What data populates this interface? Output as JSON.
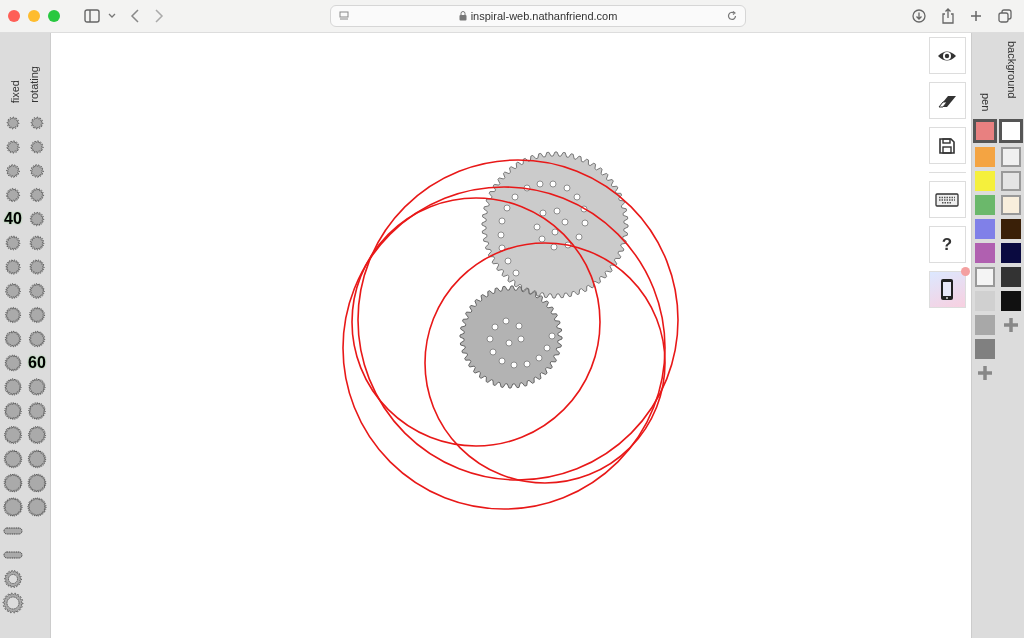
{
  "browser": {
    "url": "inspiral-web.nathanfriend.com"
  },
  "gear_picker": {
    "fixed_label": "fixed",
    "rotating_label": "rotating",
    "fixed": [
      {
        "kind": "gear",
        "selected": false
      },
      {
        "kind": "gear",
        "selected": false
      },
      {
        "kind": "gear",
        "selected": false
      },
      {
        "kind": "gear",
        "selected": false
      },
      {
        "kind": "gear",
        "selected": true,
        "label": "40"
      },
      {
        "kind": "gear",
        "selected": false
      },
      {
        "kind": "gear",
        "selected": false
      },
      {
        "kind": "gear",
        "selected": false
      },
      {
        "kind": "gear",
        "selected": false
      },
      {
        "kind": "gear",
        "selected": false
      },
      {
        "kind": "gear",
        "selected": false
      },
      {
        "kind": "gear",
        "selected": false
      },
      {
        "kind": "gear",
        "selected": false
      },
      {
        "kind": "gear",
        "selected": false
      },
      {
        "kind": "gear",
        "selected": false
      },
      {
        "kind": "gear",
        "selected": false
      },
      {
        "kind": "gear",
        "selected": false
      },
      {
        "kind": "rail",
        "selected": false
      },
      {
        "kind": "rail",
        "selected": false
      },
      {
        "kind": "ring",
        "selected": false
      },
      {
        "kind": "ring",
        "selected": false
      }
    ],
    "rotating": [
      {
        "kind": "gear",
        "selected": false
      },
      {
        "kind": "gear",
        "selected": false
      },
      {
        "kind": "gear",
        "selected": false
      },
      {
        "kind": "gear",
        "selected": false
      },
      {
        "kind": "gear",
        "selected": false
      },
      {
        "kind": "gear",
        "selected": false
      },
      {
        "kind": "gear",
        "selected": false
      },
      {
        "kind": "gear",
        "selected": false
      },
      {
        "kind": "gear",
        "selected": false
      },
      {
        "kind": "gear",
        "selected": false
      },
      {
        "kind": "gear",
        "selected": true,
        "label": "60"
      },
      {
        "kind": "gear",
        "selected": false
      },
      {
        "kind": "gear",
        "selected": false
      },
      {
        "kind": "gear",
        "selected": false
      },
      {
        "kind": "gear",
        "selected": false
      },
      {
        "kind": "gear",
        "selected": false
      },
      {
        "kind": "gear",
        "selected": false
      }
    ]
  },
  "tools": [
    {
      "kind": "view"
    },
    {
      "kind": "erase"
    },
    {
      "kind": "save"
    },
    {
      "kind": "divider"
    },
    {
      "kind": "keyboard"
    },
    {
      "kind": "help",
      "label": "?"
    },
    {
      "kind": "mobile",
      "badge": true
    }
  ],
  "colors": {
    "pen_label": "pen",
    "background_label": "background",
    "pen": [
      {
        "color": "#e88080",
        "selected": true
      },
      {
        "color": "#f4a442",
        "selected": false
      },
      {
        "color": "#f5f03c",
        "selected": false
      },
      {
        "color": "#6bb86b",
        "selected": false
      },
      {
        "color": "#8080e8",
        "selected": false
      },
      {
        "color": "#b060b0",
        "selected": false
      },
      {
        "color": "#f4f4f4",
        "selected": false
      },
      {
        "color": "#d0d0d0",
        "selected": false
      },
      {
        "color": "#a8a8a8",
        "selected": false
      },
      {
        "color": "#808080",
        "selected": false
      }
    ],
    "background": [
      {
        "color": "#ffffff",
        "selected": true
      },
      {
        "color": "#f0f0f0",
        "selected": false
      },
      {
        "color": "#e4e4e4",
        "selected": false
      },
      {
        "color": "#f8eedc",
        "selected": false
      },
      {
        "color": "#3a2008",
        "selected": false
      },
      {
        "color": "#0a0a40",
        "selected": false
      },
      {
        "color": "#333333",
        "selected": false
      },
      {
        "color": "#111111",
        "selected": false
      }
    ]
  }
}
